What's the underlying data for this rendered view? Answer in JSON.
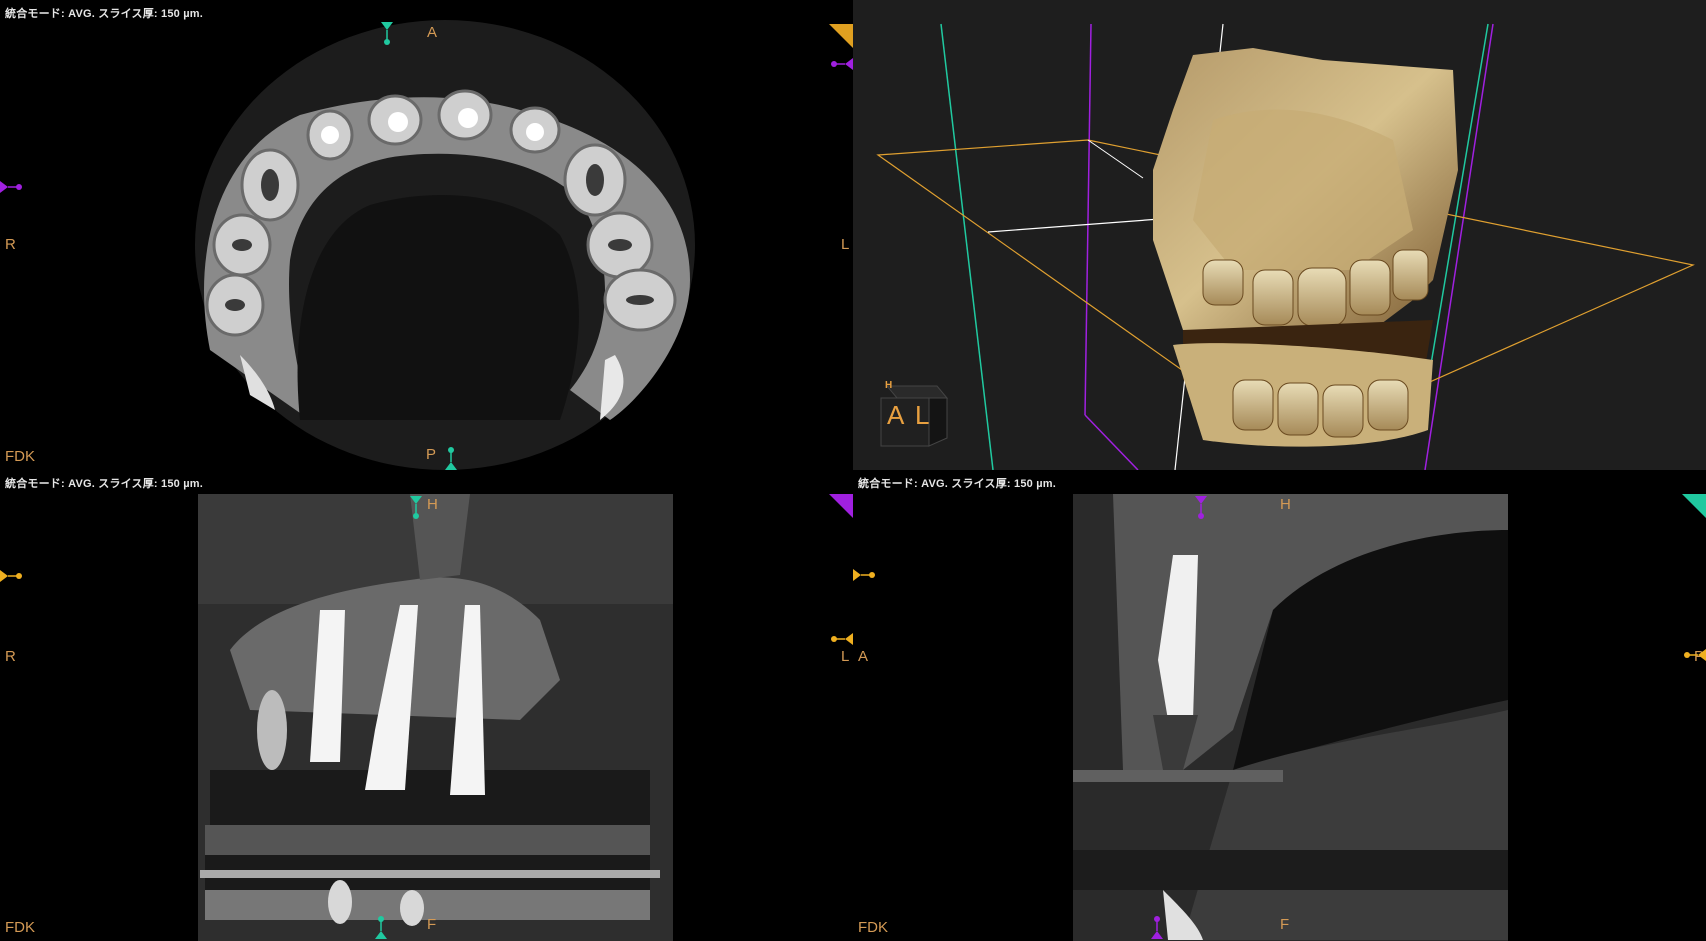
{
  "panes": {
    "axial": {
      "info": "統合モード: AVG. スライス厚: 150 µm.",
      "top": "A",
      "bottom": "P",
      "left": "R",
      "right": "L",
      "algo": "FDK"
    },
    "volume3d": {
      "cube_front": "A",
      "cube_side": "L",
      "cube_top": "H"
    },
    "coronal": {
      "info": "統合モード: AVG. スライス厚: 150 µm.",
      "top": "H",
      "bottom": "F",
      "left": "R",
      "right": "L",
      "algo": "FDK"
    },
    "sagittal": {
      "info": "統合モード: AVG. スライス厚: 150 µm.",
      "top": "H",
      "bottom": "F",
      "left": "A",
      "right": "P",
      "algo": "FDK"
    }
  },
  "colors": {
    "label_orange": "#d49a55",
    "axial_pin": "#20c9a0",
    "coronal_pin": "#f0b020",
    "sagittal_pin": "#a020e0",
    "bbox": "#e0a030"
  }
}
